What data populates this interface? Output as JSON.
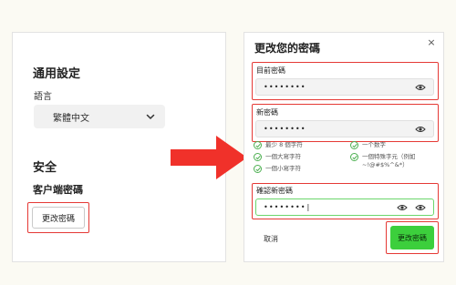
{
  "left_panel": {
    "general_title": "通用設定",
    "language_label": "語言",
    "language_value": "繁體中文",
    "security_title": "安全",
    "client_password_title": "客户端密碼",
    "change_password_button": "更改密碼"
  },
  "dialog": {
    "title": "更改您的密碼",
    "close": "×",
    "current_password_label": "目前密碼",
    "current_password_value": "••••••••",
    "new_password_label": "新密碼",
    "new_password_value": "••••••••",
    "requirements": [
      {
        "text": "最少 8 個字符"
      },
      {
        "text": "一个数字"
      },
      {
        "text": "一個大寫字符"
      },
      {
        "text": "一個特殊字元（例如 ~!@#$%^&*）"
      },
      {
        "text": "一個小寫字符"
      }
    ],
    "confirm_password_label": "確認新密碼",
    "confirm_password_value": "••••••••|",
    "cancel_button": "取消",
    "submit_button": "更改密碼"
  },
  "colors": {
    "highlight_red": "#e53935",
    "arrow_red": "#f0312a",
    "success_green": "#3ccf3c",
    "check_green": "#4caf50"
  },
  "icons": [
    "chevron-down-icon",
    "eye-icon",
    "eye-slash-icon",
    "check-circle-icon",
    "close-icon",
    "right-arrow-icon"
  ]
}
